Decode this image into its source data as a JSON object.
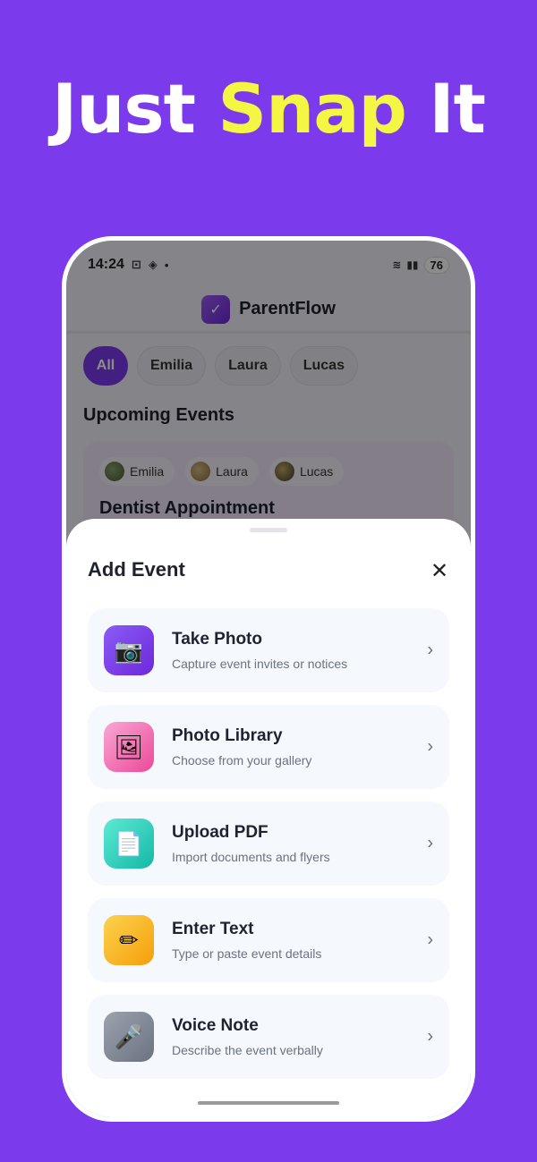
{
  "headline": {
    "part1": "Just",
    "accent": "Snap",
    "part2": "It"
  },
  "status_bar": {
    "time": "14:24",
    "battery": "76"
  },
  "app": {
    "title": "ParentFlow"
  },
  "filters": [
    {
      "label": "All",
      "active": true
    },
    {
      "label": "Emilia",
      "active": false
    },
    {
      "label": "Laura",
      "active": false
    },
    {
      "label": "Lucas",
      "active": false
    }
  ],
  "section_title": "Upcoming Events",
  "event": {
    "people": [
      "Emilia",
      "Laura",
      "Lucas"
    ],
    "title": "Dentist Appointment"
  },
  "sheet": {
    "title": "Add Event",
    "options": [
      {
        "title": "Take Photo",
        "subtitle": "Capture event invites or notices",
        "icon": "camera-icon",
        "glyph": "📷",
        "color": "#7C3AED"
      },
      {
        "title": "Photo Library",
        "subtitle": "Choose from your gallery",
        "icon": "picture-icon",
        "glyph": "🖼",
        "color": "#F472B6"
      },
      {
        "title": "Upload PDF",
        "subtitle": "Import documents and flyers",
        "icon": "document-icon",
        "glyph": "📄",
        "color": "#2DD4BF"
      },
      {
        "title": "Enter Text",
        "subtitle": "Type or paste event details",
        "icon": "pencil-icon",
        "glyph": "✏",
        "color": "#FBBF24"
      },
      {
        "title": "Voice Note",
        "subtitle": "Describe the event verbally",
        "icon": "microphone-icon",
        "glyph": "🎤",
        "color": "#6B7280"
      }
    ]
  }
}
